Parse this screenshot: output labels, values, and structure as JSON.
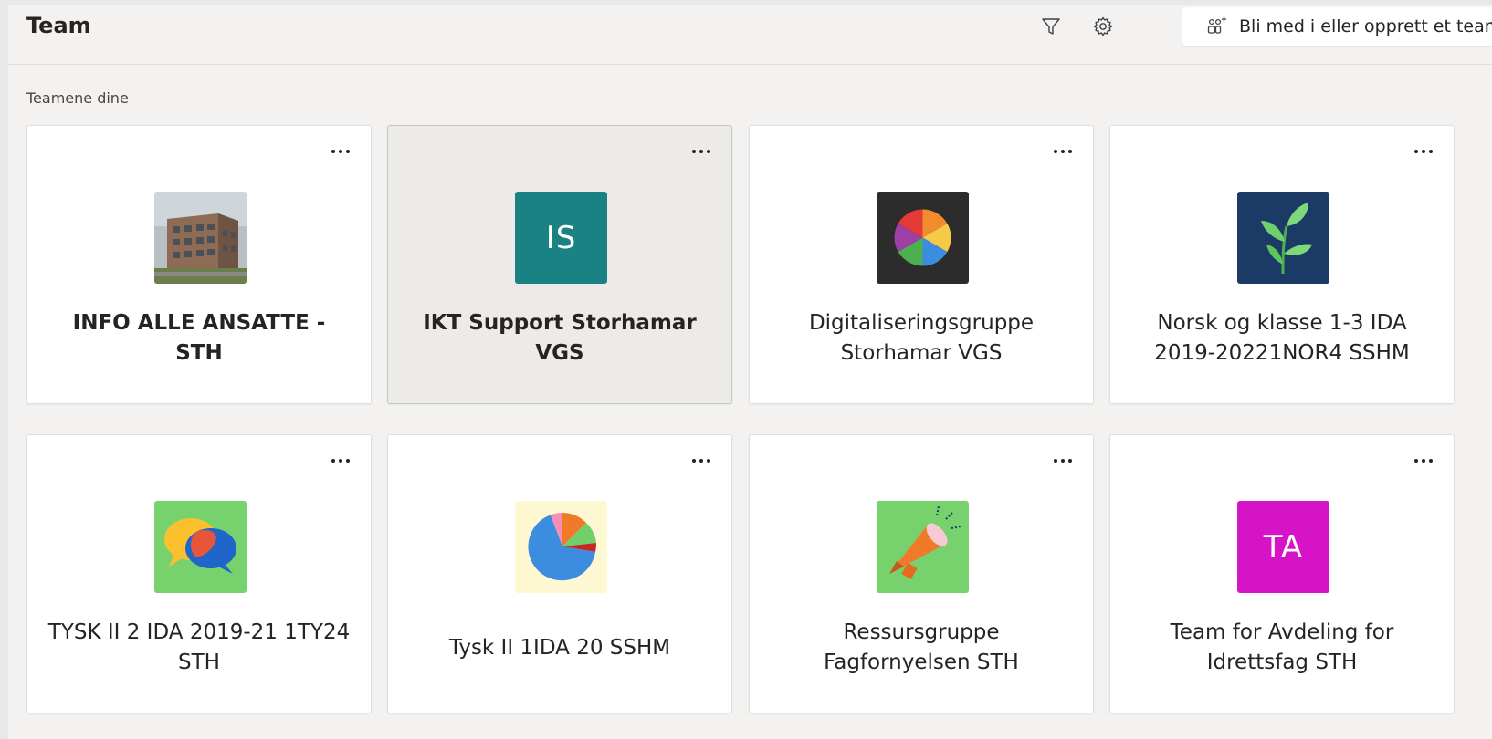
{
  "header": {
    "title": "Team",
    "join_label": "Bli med i eller opprett et team",
    "icons": [
      "filter-icon",
      "settings-gear-icon",
      "people-add-icon"
    ]
  },
  "section_label": "Teamene dine",
  "teams": [
    {
      "name": "INFO ALLE ANSATTE - STH",
      "avatar": "building-photo",
      "bold": true
    },
    {
      "name": "IKT Support Storhamar VGS",
      "avatar": "initials",
      "initials": "IS",
      "color": "#1a8282",
      "bold": true,
      "selected": true
    },
    {
      "name": "Digitaliseringsgruppe Storhamar VGS",
      "avatar": "color-wheel",
      "color": "#2d2c2c"
    },
    {
      "name": "Norsk og klasse 1-3 IDA 2019-20221NOR4 SSHM",
      "avatar": "leaf",
      "color": "#1b3a66"
    },
    {
      "name": "TYSK II 2 IDA 2019-21 1TY24 STH",
      "avatar": "speech-bubbles",
      "color": "#77d26e"
    },
    {
      "name": "Tysk II 1IDA 20 SSHM",
      "avatar": "pie-chart",
      "color": "#fdf7d2"
    },
    {
      "name": "Ressursgruppe Fagfornyelsen STH",
      "avatar": "megaphone",
      "color": "#77d26e"
    },
    {
      "name": "Team for Avdeling for Idrettsfag STH",
      "avatar": "initials",
      "initials": "TA",
      "color": "#d613c6"
    }
  ]
}
